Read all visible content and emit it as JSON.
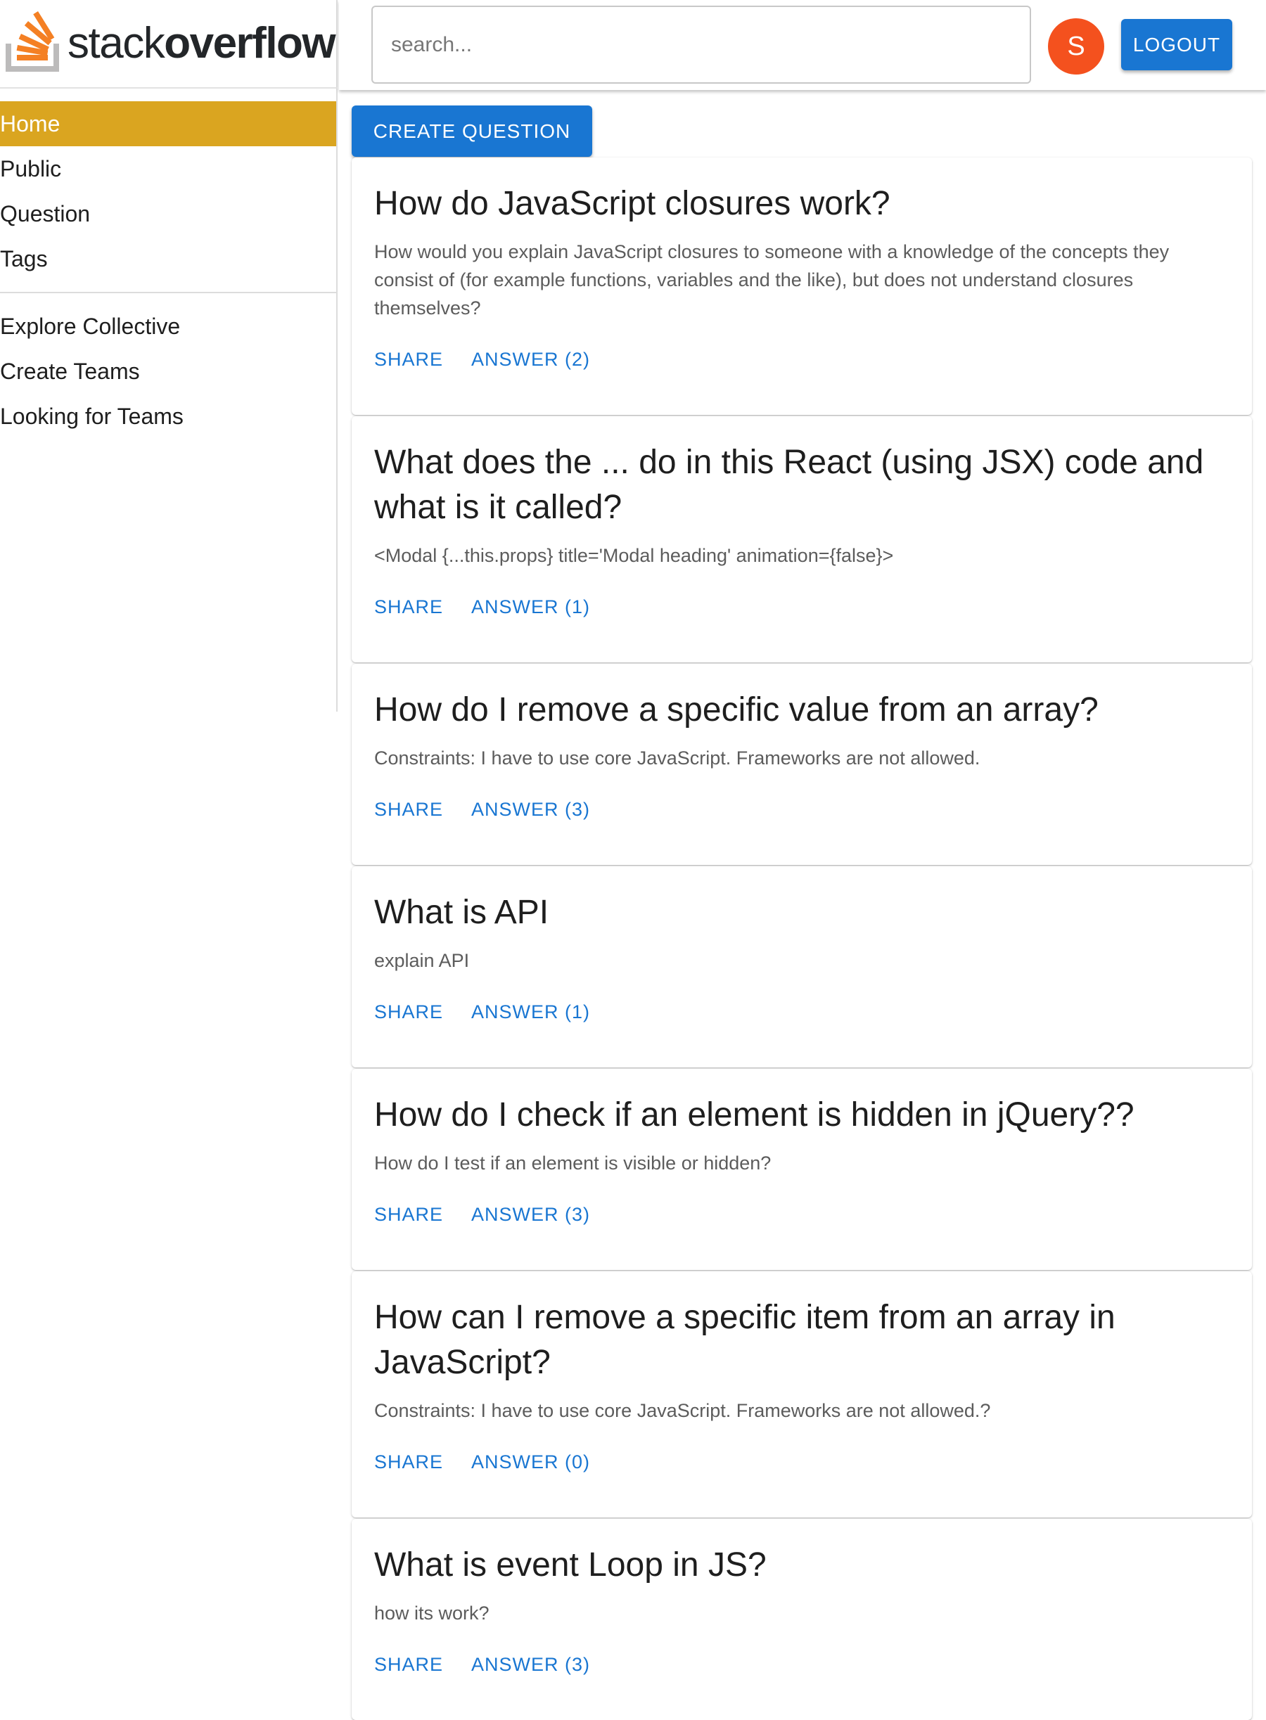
{
  "brand": {
    "word1": "stack",
    "word2": "overflow",
    "colors": {
      "orange": "#f48024",
      "gray": "#bcbbbb"
    }
  },
  "sidebar": {
    "primary": [
      {
        "label": "Home",
        "active": true
      },
      {
        "label": "Public",
        "active": false
      },
      {
        "label": "Question",
        "active": false
      },
      {
        "label": "Tags",
        "active": false
      }
    ],
    "secondary": [
      {
        "label": "Explore Collective"
      },
      {
        "label": "Create Teams"
      },
      {
        "label": "Looking for Teams"
      }
    ],
    "active_color": "#daa520"
  },
  "header": {
    "search_placeholder": "search...",
    "avatar_letter": "S",
    "avatar_color": "#f4511e",
    "logout_label": "LOGOUT"
  },
  "main": {
    "create_label": "CREATE QUESTION",
    "accent": "#1976d2",
    "questions": [
      {
        "title": "How do JavaScript closures work?",
        "body": "How would you explain JavaScript closures to someone with a knowledge of the concepts they consist of (for example functions, variables and the like), but does not understand closures themselves?",
        "share": "SHARE",
        "answer": "ANSWER (2)"
      },
      {
        "title": "What does the ... do in this React (using JSX) code and what is it called?",
        "body": "<Modal {...this.props} title='Modal heading' animation={false}>",
        "share": "SHARE",
        "answer": "ANSWER (1)"
      },
      {
        "title": "How do I remove a specific value from an array?",
        "body": "Constraints: I have to use core JavaScript. Frameworks are not allowed.",
        "share": "SHARE",
        "answer": "ANSWER (3)"
      },
      {
        "title": "What is API",
        "body": "explain API",
        "share": "SHARE",
        "answer": "ANSWER (1)"
      },
      {
        "title": "How do I check if an element is hidden in jQuery??",
        "body": "How do I test if an element is visible or hidden?",
        "share": "SHARE",
        "answer": "ANSWER (3)"
      },
      {
        "title": "How can I remove a specific item from an array in JavaScript?",
        "body": "Constraints: I have to use core JavaScript. Frameworks are not allowed.?",
        "share": "SHARE",
        "answer": "ANSWER (0)"
      },
      {
        "title": "What is event Loop in JS?",
        "body": "how its work?",
        "share": "SHARE",
        "answer": "ANSWER (3)"
      }
    ]
  }
}
